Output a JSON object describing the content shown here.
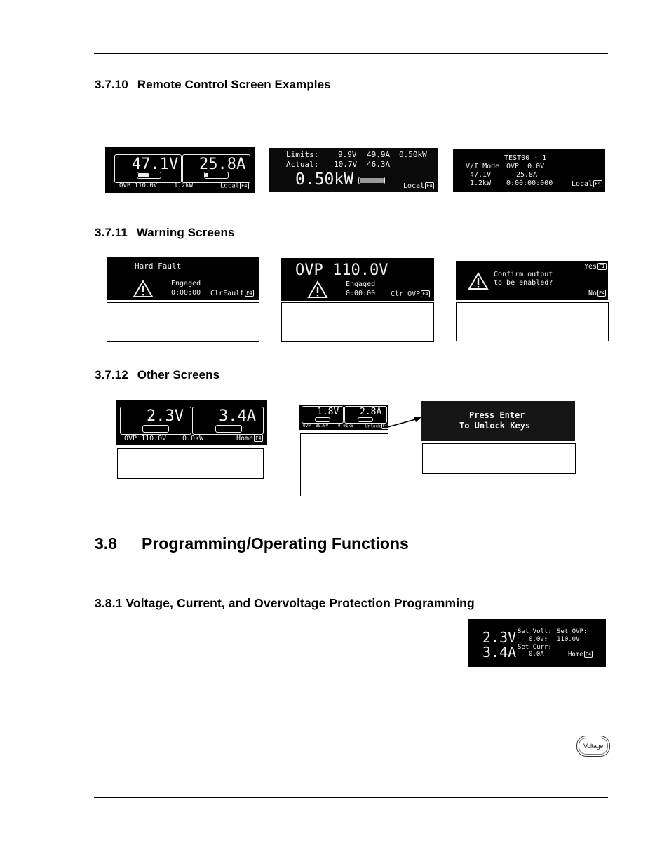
{
  "sections": {
    "s3710": {
      "num": "3.7.10",
      "title": "Remote Control Screen Examples"
    },
    "s3711": {
      "num": "3.7.11",
      "title": "Warning Screens"
    },
    "s3712": {
      "num": "3.7.12",
      "title": "Other Screens"
    },
    "s38": {
      "num": "3.8",
      "title": "Programming/Operating Functions"
    },
    "s381": {
      "num": "3.8.1",
      "title": "Voltage, Current, and Overvoltage Protection Programming"
    }
  },
  "remote_screens": {
    "screen1": {
      "voltage": "47.1V",
      "current": "25.8A",
      "voltage_bar_fraction": 0.45,
      "current_bar_fraction": 0.12,
      "ovp": "OVP 110.0V",
      "power": "1.2kW",
      "mode": "Local",
      "fkey": "F4"
    },
    "screen2": {
      "limits_label": "Limits:",
      "limit_v": "9.9V",
      "limit_a": "49.9A",
      "limit_kw": "0.50kW",
      "actual_label": "Actual:",
      "actual_v": "10.7V",
      "actual_a": "46.3A",
      "power": "0.50kW",
      "mode": "Local",
      "fkey": "F4"
    },
    "screen3": {
      "title": "TEST00 - 1",
      "mode_label": "V/I Mode",
      "ovp": "OVP  0.0V",
      "voltage": "47.1V",
      "current": "25.8A",
      "power": "1.2kW",
      "time": "0:00:00:000",
      "mode": "Local",
      "fkey": "F4"
    }
  },
  "warning_screens": {
    "hard_fault": {
      "title": "Hard Fault",
      "status": "Engaged",
      "time": "0:00:00",
      "action": "ClrFault",
      "fkey": "F4"
    },
    "ovp": {
      "title": "OVP 110.0V",
      "status": "Engaged",
      "time": "0:00:00",
      "action": "Clr OVP",
      "fkey": "F4"
    },
    "confirm": {
      "line1": "Confirm output",
      "line2": "to be enabled?",
      "yes": "Yes",
      "yes_fkey": "F1",
      "no": "No",
      "no_fkey": "F4"
    }
  },
  "other_screens": {
    "home": {
      "voltage": "2.3V",
      "current": "3.4A",
      "ovp": "OVP 110.0V",
      "power": "0.0kW",
      "mode": "Home",
      "fkey": "F4"
    },
    "locked": {
      "voltage": "1.8V",
      "current": "2.8A",
      "ovp": "OVP  88.0V",
      "power": "0.01kW",
      "mode": "Unlock",
      "fkey": "F4"
    },
    "unlock_prompt": {
      "line1": "Press Enter",
      "line2": "To Unlock Keys"
    }
  },
  "set_screen": {
    "voltage": "2.3V",
    "current": "3.4A",
    "set_volt_label": "Set Volt:",
    "set_volt_value": "0.0V↕",
    "set_ovp_label": "Set OVP:",
    "set_ovp_value": "110.0V",
    "set_curr_label": "Set Curr:",
    "set_curr_value": "0.0A",
    "mode": "Home",
    "fkey": "F4"
  },
  "voltage_key": {
    "label": "Voltage"
  }
}
